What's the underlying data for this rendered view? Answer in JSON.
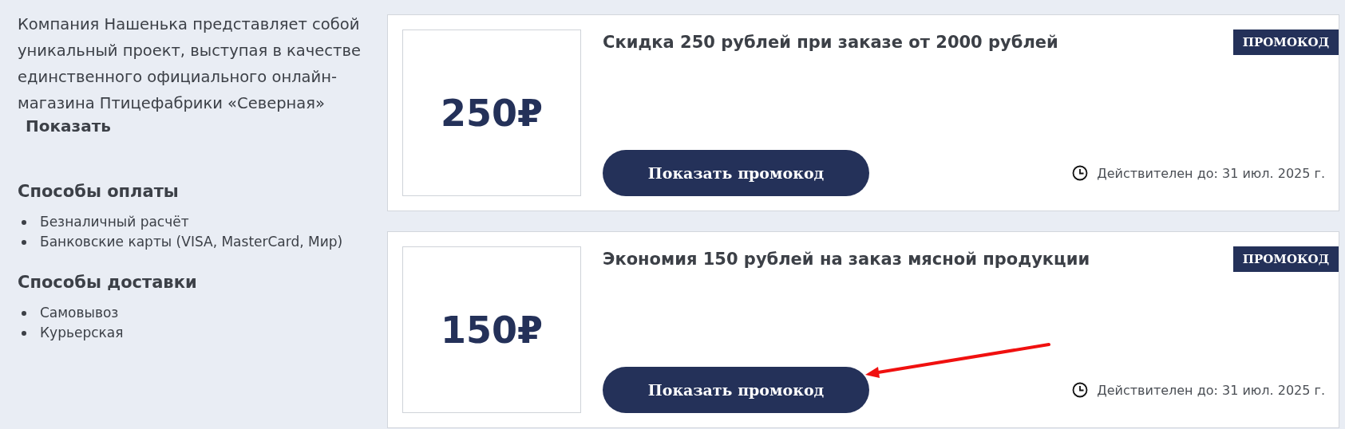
{
  "about": {
    "text": "Компания Нашенька представляет собой уникальный проект, выступая в качестве единственного официального онлайн-магазина Птицефабрики «Северная»",
    "more_link": "Показать"
  },
  "payment": {
    "title": "Способы оплаты",
    "items": [
      "Безналичный расчёт",
      "Банковские карты (VISA, MasterCard, Мир)"
    ]
  },
  "delivery": {
    "title": "Способы доставки",
    "items": [
      "Самовывоз",
      "Курьерская"
    ]
  },
  "promos": [
    {
      "amount": "250₽",
      "title": "Скидка 250 рублей при заказе от 2000 рублей",
      "badge": "ПРОМОКОД",
      "button": "Показать промокод",
      "valid_until": "Действителен до: 31 июл. 2025 г."
    },
    {
      "amount": "150₽",
      "title": "Экономия 150 рублей на заказ мясной продукции",
      "badge": "ПРОМОКОД",
      "button": "Показать промокод",
      "valid_until": "Действителен до: 31 июл. 2025 г."
    }
  ]
}
